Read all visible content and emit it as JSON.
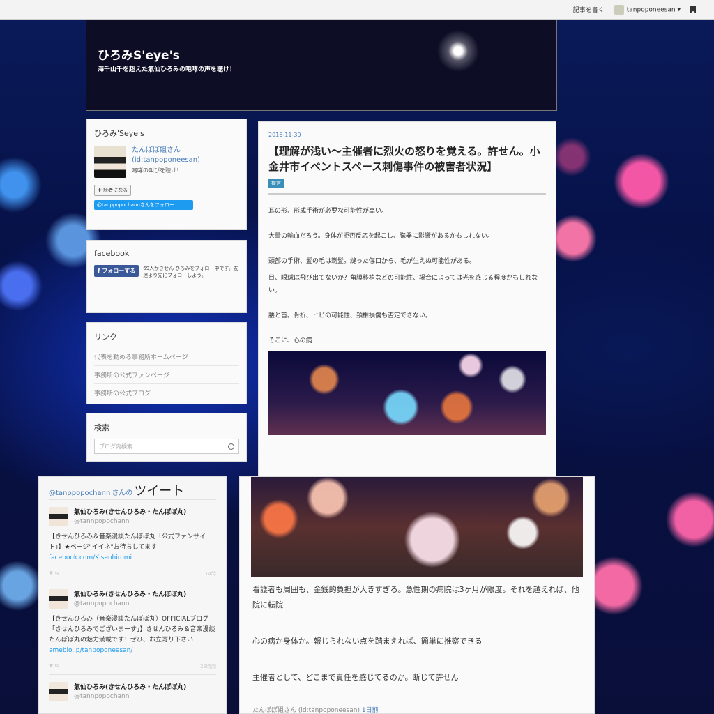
{
  "topbar": {
    "write_label": "記事を書く",
    "user_label": "tanpoponeesan ▾"
  },
  "header": {
    "title": "ひろみS'eye's",
    "subtitle": "海千山千を超えた氣仙ひろみの咆哮の声を聴け！"
  },
  "profile": {
    "heading": "ひろみ'Seye's",
    "name": "たんぽぽ姐さん",
    "id": "(id:tanpoponeesan)",
    "desc": "咆哮の叫びを聴け！",
    "reader_button": "✚ 読者になる",
    "twitter_button": "@tanppopochannさんをフォロー"
  },
  "facebook": {
    "heading": "facebook",
    "follow_button": "f  フォローする",
    "text": "69人がきせん ひろみをフォロー中です。友達より先にフォローしよう。"
  },
  "links": {
    "heading": "リンク",
    "items": [
      "代表を勤める事務所ホームページ",
      "事務所の公式ファンページ",
      "事務所の公式ブログ"
    ]
  },
  "search": {
    "heading": "検索",
    "placeholder": "ブログ内検索"
  },
  "post": {
    "date": "2016-11-30",
    "title": "【理解が浅い〜主催者に烈火の怒りを覚える。許せん。小金井市イベントスペース刺傷事件の被害者状況】",
    "tag": "提言",
    "paragraphs": [
      "耳の形、形成手術が必要な可能性が高い。",
      "大量の輸血だろう。身体が拒否反応を起こし、臓器に影響があるかもしれない。",
      "頭部の手術、髪の毛は剃髪。縫った傷口から、毛が生えぬ可能性がある。",
      "目、眼球は飛び出てないか？角膜移植などの可能性、場合によっては光を感じる程度かもしれない。",
      "腰と首。骨折、ヒビの可能性、頚椎損傷も否定できない。",
      "そこに、心の病"
    ],
    "paragraphs2": [
      "看護者も周囲も、金銭的負担が大きすぎる。急性期の病院は3ヶ月が限度。それを越えれば、他院に転院",
      "心の病か身体か。報じられない点を踏まえれば、簡単に推察できる",
      "主催者として、どこまで責任を感じてるのか。断じて許せん"
    ],
    "author": "たんぽぽ姐さん (id:tanpoponeesan)",
    "time": "1日前"
  },
  "tweets": {
    "header_handle": "@tanppopochann",
    "header_san": "さんの",
    "header_big": "ツイート",
    "items": [
      {
        "name": "氣仙ひろみ(きせんひろみ・たんぽぽ丸)",
        "handle": "@tannpopochann",
        "text": "【きせんひろみ＆音楽漫談たんぽぽ丸「公式ファンサイト」】★ページ\"イイネ\"お待ちしてます",
        "link": "facebook.com/Kisenhiromi",
        "meta": "14時"
      },
      {
        "name": "氣仙ひろみ(きせんひろみ・たんぽぽ丸)",
        "handle": "@tannpopochann",
        "text": "【きせんひろみ（音楽漫談たんぽぽ丸）OFFICIALブログ「きせんひろみでございまーす」】きせんひろみ＆音楽漫談たんぽぽ丸の魅力満載です！ぜひ、お立寄り下さい",
        "link": "ameblo.jp/tanpoponeesan/",
        "meta": "28時間"
      },
      {
        "name": "氣仙ひろみ(きせんひろみ・たんぽぽ丸)",
        "handle": "@tannpopochann",
        "text": "",
        "link": "",
        "meta": ""
      }
    ]
  }
}
